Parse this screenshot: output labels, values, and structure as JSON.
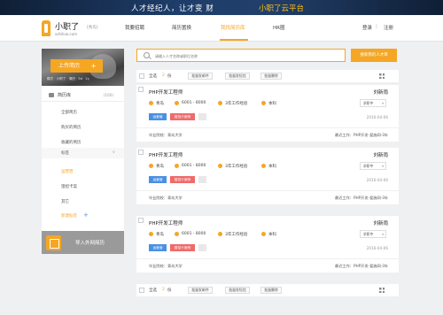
{
  "banner": {
    "slogan": "人才经纪人，让才变 财",
    "cta": "小职了云平台"
  },
  "nav": {
    "logo_name": "小职了",
    "logo_domain": "xzhiliao.com",
    "city": "[青岛]",
    "links": [
      "我要招聘",
      "简历置换",
      "我找简历库",
      "HR圈"
    ],
    "active_index": 2,
    "login": "登录",
    "separator": "|",
    "register": "注册"
  },
  "sidebar": {
    "upload_label": "上传简历",
    "upload_plus": "+",
    "photo_caption": "模式 · 小职了 · 简历 · 5d · 2y",
    "library_label": "简历库",
    "library_count": "(100)",
    "items": [
      "全部简历",
      "购买的简历",
      "收藏的简历",
      "标签",
      "运营营",
      "猎招卡案",
      "其它"
    ],
    "active_item_index": 4,
    "toggle_chevron": "∨",
    "new_tag": "新建标签",
    "new_tag_plus": "+",
    "import_label": "导入外网简历"
  },
  "search": {
    "placeholder": "请输入人才名称或职位名称",
    "button": "搜索我的人才库"
  },
  "toolbar": {
    "select_all": "全选",
    "count": "2",
    "count_unit": "份",
    "buttons": [
      "批量发邮件",
      "批量发短信",
      "批量删除"
    ]
  },
  "resumes": [
    {
      "title": "PHP开发工程师",
      "name": "刘新雨",
      "city": "青岛",
      "salary": "6001 - 8000",
      "experience": "3年工作经验",
      "education": "本科",
      "status": "求职中",
      "tags": [
        "运营营",
        "猎招卡案例"
      ],
      "date": "2016-04-06",
      "school_label": "毕业院校：",
      "school": "青岛大学",
      "work_label": "最近工作：",
      "work": "PHP开发-爱施网-3年"
    },
    {
      "title": "PHP开发工程师",
      "name": "刘新雨",
      "city": "青岛",
      "salary": "6001 - 8000",
      "experience": "3年工作经验",
      "education": "本科",
      "status": "求职中",
      "tags": [
        "运营营",
        "猎招卡案例"
      ],
      "date": "2016-04-06",
      "school_label": "毕业院校：",
      "school": "青岛大学",
      "work_label": "最近工作：",
      "work": "PHP开发-爱施网-3年"
    },
    {
      "title": "PHP开发工程师",
      "name": "刘新雨",
      "city": "青岛",
      "salary": "6001 - 8000",
      "experience": "3年工作经验",
      "education": "本科",
      "status": "求职中",
      "tags": [
        "运营营",
        "猎招卡案例"
      ],
      "date": "2016-04-06",
      "school_label": "毕业院校：",
      "school": "青岛大学",
      "work_label": "最近工作：",
      "work": "PHP开发-爱施网-3年"
    }
  ]
}
